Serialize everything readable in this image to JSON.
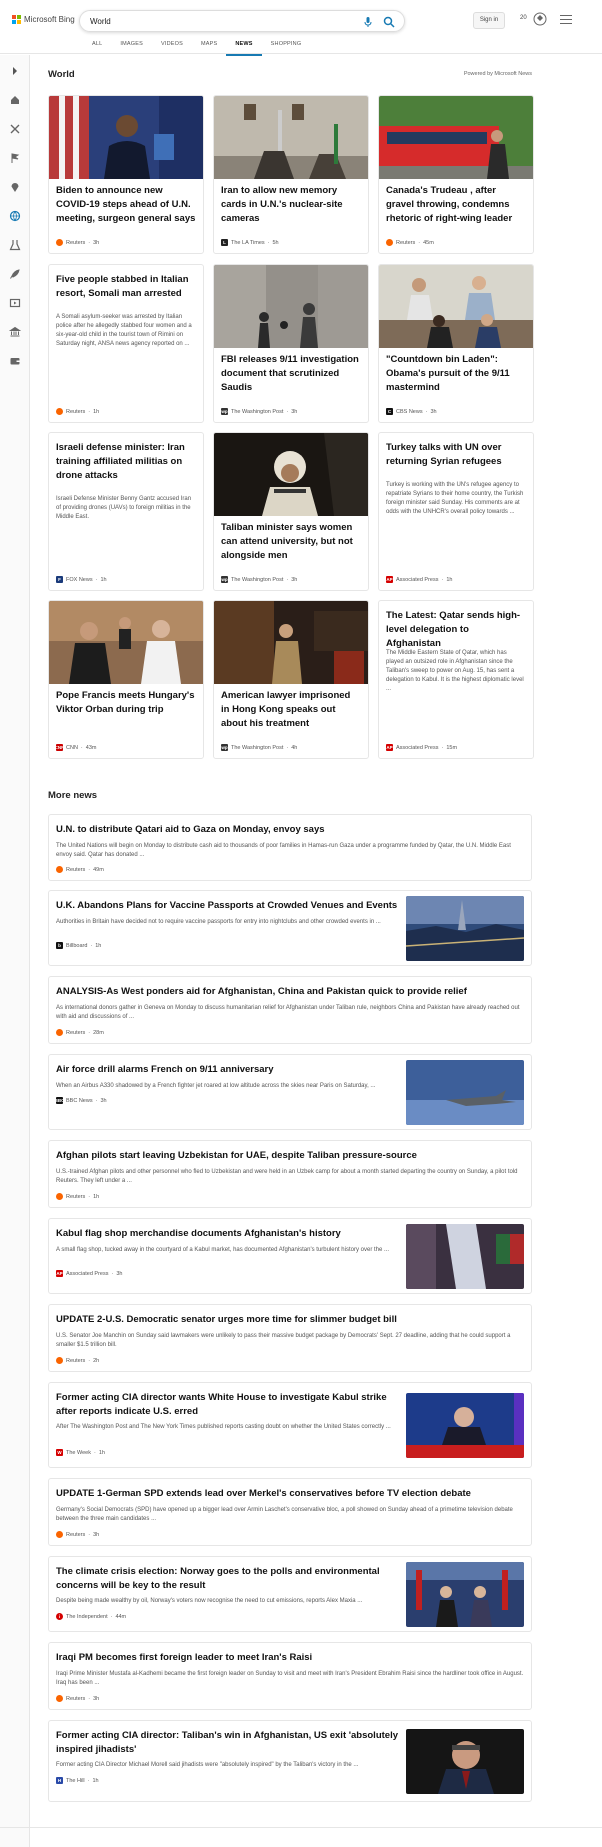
{
  "header": {
    "brand": "Microsoft Bing",
    "search_value": "World",
    "signin_label": "Sign in",
    "points": "20",
    "tabs": [
      {
        "label": "ALL",
        "active": false
      },
      {
        "label": "IMAGES",
        "active": false
      },
      {
        "label": "VIDEOS",
        "active": false
      },
      {
        "label": "MAPS",
        "active": false
      },
      {
        "label": "NEWS",
        "active": true
      },
      {
        "label": "SHOPPING",
        "active": false
      }
    ]
  },
  "sidebar": {
    "icons": [
      "chevron-right-icon",
      "home-icon",
      "sports-icon",
      "flag-icon",
      "location-icon",
      "globe-icon",
      "science-icon",
      "rocket-icon",
      "entertainment-icon",
      "bank-icon",
      "wallet-icon"
    ]
  },
  "world": {
    "title": "World",
    "powered_by": "Powered by Microsoft News",
    "cards": [
      {
        "title": "Biden to announce new COVID-19 steps ahead of U.N. meeting, surgeon general says",
        "desc": "",
        "source": "Reuters",
        "time": "3h"
      },
      {
        "title": "Iran to allow new memory cards in U.N.'s nuclear-site cameras",
        "desc": "",
        "source": "The LA Times",
        "time": "5h"
      },
      {
        "title": "Canada's Trudeau , after gravel throwing, condemns rhetoric of right-wing leader",
        "desc": "",
        "source": "Reuters",
        "time": "45m"
      },
      {
        "title": "Five people stabbed in Italian resort, Somali man arrested",
        "desc": "A Somali asylum-seeker was arrested by Italian police after he allegedly stabbed four women and a six-year-old child in the tourist town of Rimini on Saturday night, ANSA news agency reported on ...",
        "source": "Reuters",
        "time": "1h"
      },
      {
        "title": "FBI releases 9/11 investigation document that scrutinized Saudis",
        "desc": "",
        "source": "The Washington Post",
        "time": "3h"
      },
      {
        "title": "\"Countdown bin Laden\": Obama's pursuit of the 9/11 mastermind",
        "desc": "",
        "source": "CBS News",
        "time": "3h"
      },
      {
        "title": "Israeli defense minister: Iran training affiliated militias on drone attacks",
        "desc": "Israeli Defense Minister Benny Gantz accused Iran of providing drones (UAVs) to foreign militias in the Middle East.",
        "source": "FOX News",
        "time": "1h"
      },
      {
        "title": "Taliban minister says women can attend university, but not alongside men",
        "desc": "",
        "source": "The Washington Post",
        "time": "3h"
      },
      {
        "title": "Turkey talks with UN over returning Syrian refugees",
        "desc": "Turkey is working with the UN's refugee agency to repatriate Syrians to their home country, the Turkish foreign minister said Sunday. His comments are at odds with the UNHCR's overall policy towards ...",
        "source": "Associated Press",
        "time": "1h"
      },
      {
        "title": "Pope Francis meets Hungary's Viktor Orban during trip",
        "desc": "",
        "source": "CNN",
        "time": "43m"
      },
      {
        "title": "American lawyer imprisoned in Hong Kong speaks out about his treatment",
        "desc": "",
        "source": "The Washington Post",
        "time": "4h"
      },
      {
        "title": "The Latest: Qatar sends high-level delegation to Afghanistan",
        "desc": "The Middle Eastern State of Qatar, which has played an outsized role in Afghanistan since the Taliban's sweep to power on Aug. 15, has sent a delegation to Kabul. It is the highest diplomatic level ...",
        "source": "Associated Press",
        "time": "15m"
      }
    ]
  },
  "more_news": {
    "title": "More news",
    "items": [
      {
        "title": "U.N. to distribute Qatari aid to Gaza on Monday, envoy says",
        "desc": "The United Nations will begin on Monday to distribute cash aid to thousands of poor families in Hamas-run Gaza under a programme funded by Qatar, the U.N. Middle East envoy said. Qatar has donated ...",
        "source": "Reuters",
        "time": "49m"
      },
      {
        "title": "U.K. Abandons Plans for Vaccine Passports at Crowded Venues and Events",
        "desc": "Authorities in Britain have decided not to require vaccine passports for entry into nightclubs and other crowded events in ...",
        "source": "Billboard",
        "time": "1h"
      },
      {
        "title": "ANALYSIS-As West ponders aid for Afghanistan, China and Pakistan quick to provide relief",
        "desc": "As international donors gather in Geneva on Monday to discuss humanitarian relief for Afghanistan under Taliban rule, neighbors China and Pakistan have already reached out with aid and discussions of ...",
        "source": "Reuters",
        "time": "28m"
      },
      {
        "title": "Air force drill alarms French on 9/11 anniversary",
        "desc": "When an Airbus A330 shadowed by a French fighter jet roared at low altitude across the skies near Paris on Saturday, ...",
        "source": "BBC News",
        "time": "3h"
      },
      {
        "title": "Afghan pilots start leaving Uzbekistan for UAE, despite Taliban pressure-source",
        "desc": "U.S.-trained Afghan pilots and other personnel who fled to Uzbekistan and were held in an Uzbek camp for about a month started departing the country on Sunday, a pilot told Reuters. They left under a ...",
        "source": "Reuters",
        "time": "1h"
      },
      {
        "title": "Kabul flag shop merchandise documents Afghanistan's history",
        "desc": "A small flag shop, tucked away in the courtyard of a Kabul market, has documented Afghanistan's turbulent history over the ...",
        "source": "Associated Press",
        "time": "3h"
      },
      {
        "title": "UPDATE 2-U.S. Democratic senator urges more time for slimmer budget bill",
        "desc": "U.S. Senator Joe Manchin on Sunday said lawmakers were unlikely to pass their massive budget package by Democrats' Sept. 27 deadline, adding that he could support a smaller $1.5 trillion bill.",
        "source": "Reuters",
        "time": "2h"
      },
      {
        "title": "Former acting CIA director wants White House to investigate Kabul strike after reports indicate U.S. erred",
        "desc": "After The Washington Post and The New York Times published reports casting doubt on whether the United States correctly ...",
        "source": "The Week",
        "time": "1h"
      },
      {
        "title": "UPDATE 1-German SPD extends lead over Merkel's conservatives before TV election debate",
        "desc": "Germany's Social Democrats (SPD) have opened up a bigger lead over Armin Laschet's conservative bloc, a poll showed on Sunday ahead of a primetime television debate between the three main candidates ...",
        "source": "Reuters",
        "time": "3h"
      },
      {
        "title": "The climate crisis election: Norway goes to the polls and environmental concerns will be key to the result",
        "desc": "Despite being made wealthy by oil, Norway's voters now recognise the need to cut emissions, reports Alex Maxia ...",
        "source": "The Independent",
        "time": "44m"
      },
      {
        "title": "Iraqi PM becomes first foreign leader to meet Iran's Raisi",
        "desc": "Iraqi Prime Minister Mustafa al-Kadhemi became the first foreign leader on Sunday to visit and meet with Iran's President Ebrahim Raisi since the hardliner took office in August. Iraq has been ...",
        "source": "Reuters",
        "time": "3h"
      },
      {
        "title": "Former acting CIA director: Taliban's win in Afghanistan, US exit 'absolutely inspired jihadists'",
        "desc": "Former acting CIA Director Michael Morell said jihadists were \"absolutely inspired\" by the Taliban's victory in the ...",
        "source": "The Hill",
        "time": "1h"
      }
    ]
  },
  "colors": {
    "accent": "#177ab3",
    "reuters": "#fa6400",
    "cnn": "#cc0000",
    "ap": "#d50000"
  }
}
